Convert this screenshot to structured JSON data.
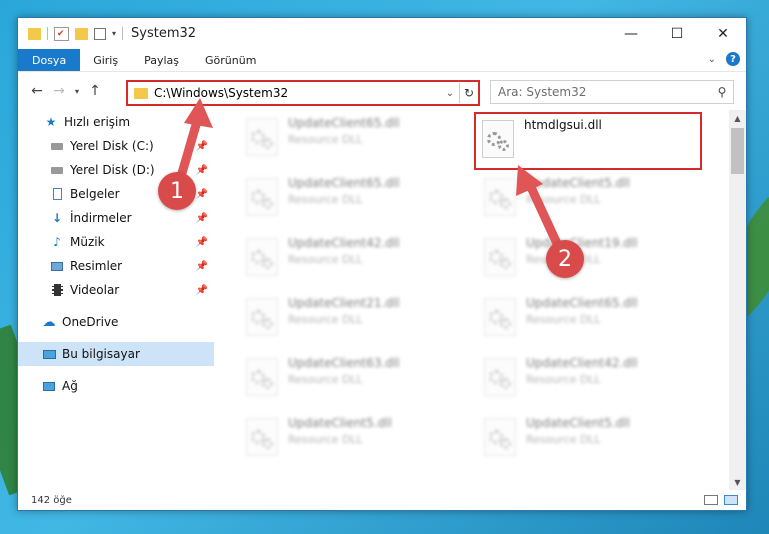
{
  "window": {
    "title": "System32"
  },
  "ribbon": {
    "tabs": [
      "Dosya",
      "Giriş",
      "Paylaş",
      "Görünüm"
    ]
  },
  "address": {
    "path": "C:\\Windows\\System32"
  },
  "search": {
    "placeholder": "Ara: System32"
  },
  "nav": {
    "quick_access": "Hızlı erişim",
    "items": [
      {
        "label": "Yerel Disk (C:)",
        "icon": "drive-icon",
        "pinned": true
      },
      {
        "label": "Yerel Disk (D:)",
        "icon": "drive-icon",
        "pinned": true
      },
      {
        "label": "Belgeler",
        "icon": "documents-icon",
        "pinned": true
      },
      {
        "label": "İndirmeler",
        "icon": "download-icon",
        "pinned": true
      },
      {
        "label": "Müzik",
        "icon": "music-icon",
        "pinned": true
      },
      {
        "label": "Resimler",
        "icon": "pictures-icon",
        "pinned": true
      },
      {
        "label": "Videolar",
        "icon": "videos-icon",
        "pinned": true
      }
    ],
    "onedrive": "OneDrive",
    "this_pc": "Bu bilgisayar",
    "network": "Ağ"
  },
  "files": [
    {
      "name": "UpdateClient65.dll",
      "desc": "Resource DLL"
    },
    {
      "name": "htmdlgsui.dll",
      "desc": ""
    },
    {
      "name": "UpdateClient65.dll",
      "desc": "Resource DLL"
    },
    {
      "name": "UpdateClient5.dll",
      "desc": "Resource DLL"
    },
    {
      "name": "UpdateClient42.dll",
      "desc": "Resource DLL"
    },
    {
      "name": "UpdateClient19.dll",
      "desc": "Resource DLL"
    },
    {
      "name": "UpdateClient21.dll",
      "desc": "Resource DLL"
    },
    {
      "name": "UpdateClient65.dll",
      "desc": "Resource DLL"
    },
    {
      "name": "UpdateClient63.dll",
      "desc": "Resource DLL"
    },
    {
      "name": "UpdateClient42.dll",
      "desc": "Resource DLL"
    },
    {
      "name": "UpdateClient5.dll",
      "desc": "Resource DLL"
    },
    {
      "name": "UpdateClient5.dll",
      "desc": "Resource DLL"
    }
  ],
  "status": {
    "count": "142 öğe"
  },
  "annotations": {
    "step1": "1",
    "step2": "2"
  },
  "colors": {
    "accent": "#1979ca",
    "highlight": "#d62b2b",
    "selection": "#cde3f7"
  }
}
